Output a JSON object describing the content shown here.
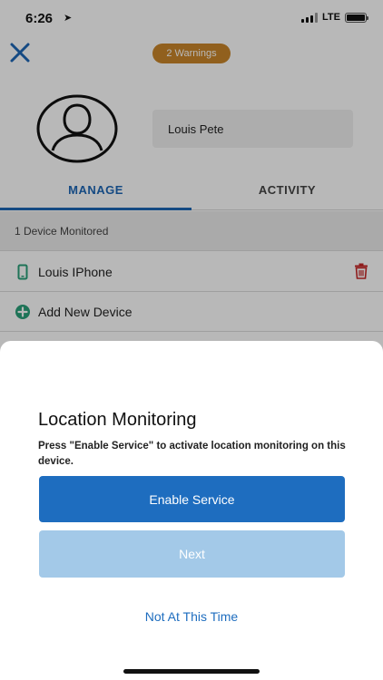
{
  "status_bar": {
    "time": "6:26",
    "network": "LTE"
  },
  "header": {
    "warnings_badge": "2 Warnings",
    "name_value": "Louis Pete"
  },
  "tabs": [
    {
      "label": "MANAGE",
      "active": true
    },
    {
      "label": "ACTIVITY",
      "active": false
    }
  ],
  "devices": {
    "section_title": "1 Device Monitored",
    "items": [
      {
        "label": "Louis IPhone"
      }
    ],
    "add_label": "Add New Device"
  },
  "dialog": {
    "title": "Location Monitoring",
    "description": "Press \"Enable Service\" to activate location monitoring on this device.",
    "primary_label": "Enable Service",
    "next_label": "Next",
    "dismiss_label": "Not At This Time"
  },
  "colors": {
    "primary": "#1e6dbf",
    "warning": "#c9862a",
    "success": "#2aa079",
    "danger": "#c62828",
    "disabled": "#a3c9e8"
  }
}
